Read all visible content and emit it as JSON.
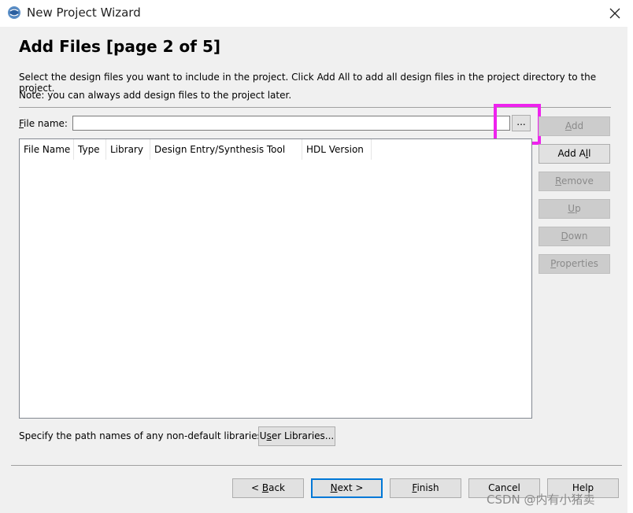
{
  "window": {
    "title": "New Project Wizard"
  },
  "page": {
    "heading": "Add Files [page 2 of 5]",
    "description": "Select the design files you want to include in the project. Click Add All to add all design files in the project directory to the project.",
    "note": "Note: you can always add design files to the project later."
  },
  "file_name": {
    "label_accel": "F",
    "label_rest": "ile name:",
    "value": "",
    "browse_label": "..."
  },
  "table": {
    "columns": [
      "File Name",
      "Type",
      "Library",
      "Design Entry/Synthesis Tool",
      "HDL Version"
    ],
    "rows": []
  },
  "side_buttons": {
    "add": {
      "accel": "A",
      "rest": "dd"
    },
    "add_all": {
      "pre": "Add A",
      "accel": "l",
      "post": "l"
    },
    "remove": {
      "accel": "R",
      "rest": "emove"
    },
    "up": {
      "accel": "U",
      "rest": "p"
    },
    "down": {
      "accel": "D",
      "rest": "own"
    },
    "properties": {
      "accel": "P",
      "rest": "roperties"
    }
  },
  "libraries": {
    "text": "Specify the path names of any non-default libraries.",
    "button_pre": "U",
    "button_accel": "s",
    "button_post": "er Libraries..."
  },
  "footer": {
    "back_pre": "< ",
    "back_accel": "B",
    "back_rest": "ack",
    "next_accel": "N",
    "next_rest": "ext >",
    "finish_accel": "F",
    "finish_rest": "inish",
    "cancel": "Cancel",
    "help": "Help"
  },
  "watermark": "CSDN @内有小猪卖",
  "colors": {
    "highlight": "#ee22ee",
    "primary_border": "#0078d7",
    "disabled_bg": "#cccccc"
  }
}
